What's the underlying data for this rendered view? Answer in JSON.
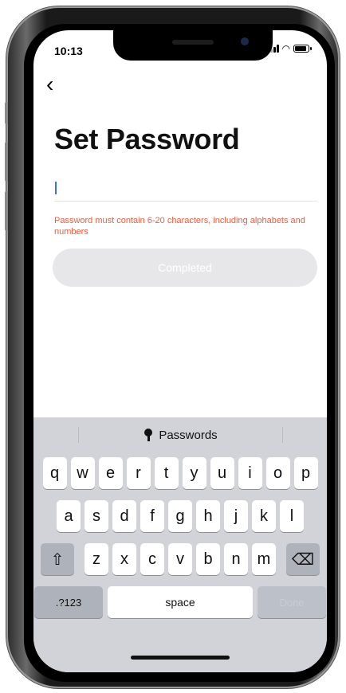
{
  "status": {
    "time": "10:13"
  },
  "header": {
    "back_icon": "chevron-left-icon",
    "title": "Set Password"
  },
  "password_field": {
    "value": "",
    "placeholder": ""
  },
  "hint": "Password must contain 6-20 characters, including alphabets and numbers",
  "primary_button": {
    "label": "Completed",
    "enabled": false
  },
  "keyboard": {
    "suggestion": {
      "icon": "key-icon",
      "label": "Passwords"
    },
    "row1": [
      "q",
      "w",
      "e",
      "r",
      "t",
      "y",
      "u",
      "i",
      "o",
      "p"
    ],
    "row2": [
      "a",
      "s",
      "d",
      "f",
      "g",
      "h",
      "j",
      "k",
      "l"
    ],
    "row3": [
      "z",
      "x",
      "c",
      "v",
      "b",
      "n",
      "m"
    ],
    "shift_symbol": "⇧",
    "delete_symbol": "⌫",
    "numbers_label": ".?123",
    "space_label": "space",
    "done_label": "Done"
  },
  "colors": {
    "hint": "#f25a3c",
    "button_disabled": "#e7e7ea",
    "caret": "#3c6fe0"
  }
}
